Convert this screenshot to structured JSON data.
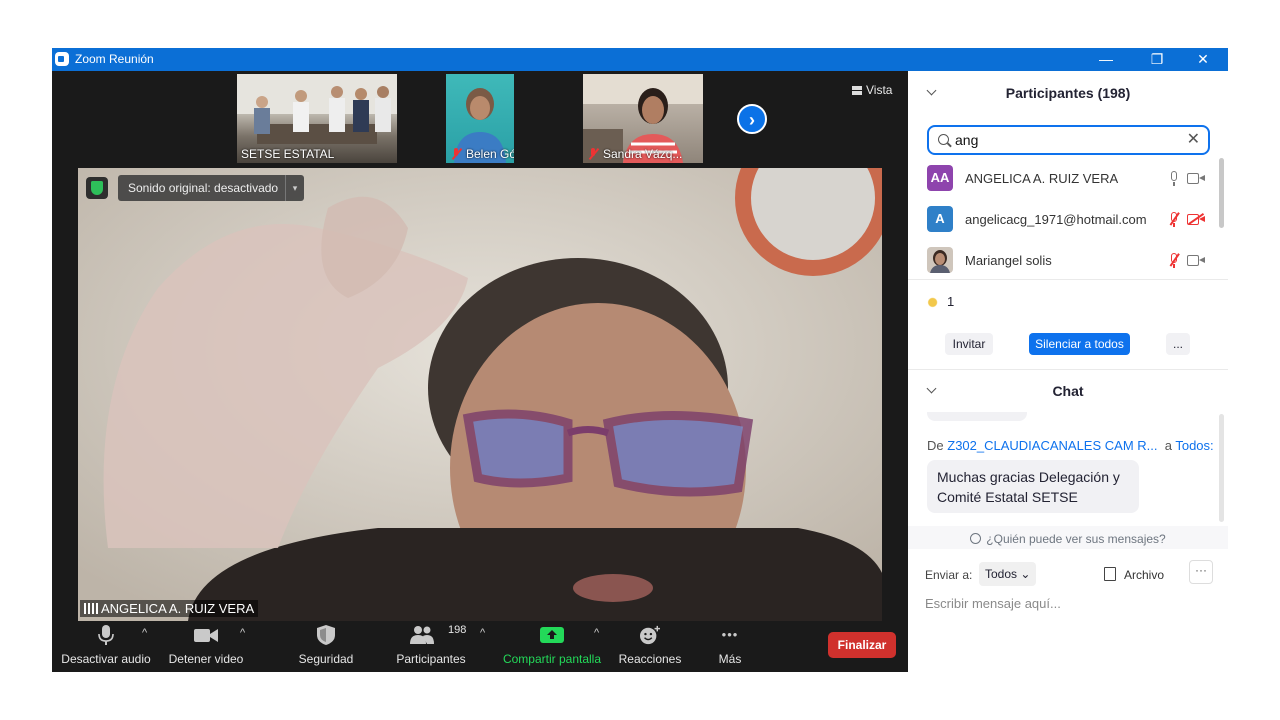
{
  "window": {
    "title": "Zoom Reunión",
    "controls": {
      "minimize": "—",
      "restore": "❐",
      "close": "✕"
    }
  },
  "thumbnails": [
    {
      "name": "SETSE ESTATAL",
      "muted": false
    },
    {
      "name": "Belen Gómez",
      "muted": true
    },
    {
      "name": "Sandra Vázq...",
      "muted": true
    }
  ],
  "view_button": "Vista",
  "next_arrow": "›",
  "video": {
    "original_sound": "Sonido original: desactivado",
    "dropdown_glyph": "▾",
    "speaker_name": "ANGELICA A. RUIZ VERA"
  },
  "toolbar": {
    "audio": "Desactivar audio",
    "video": "Detener video",
    "security": "Seguridad",
    "participants": "Participantes",
    "participants_count": "198",
    "share": "Compartir pantalla",
    "reactions": "Reacciones",
    "more": "Más",
    "more_glyph": "•••",
    "caret": "^",
    "end": "Finalizar"
  },
  "participants_panel": {
    "title": "Participantes (198)",
    "search_value": "ang",
    "search_clear": "✕",
    "list": [
      {
        "initials": "AA",
        "name": "ANGELICA A. RUIZ VERA",
        "avatar_color": "#8e44ad",
        "mic_muted": false,
        "cam_off": false
      },
      {
        "initials": "A",
        "name": "angelicacg_1971@hotmail.com",
        "avatar_color": "#2f80c8",
        "mic_muted": true,
        "cam_off": true
      },
      {
        "initials": "",
        "name": "Mariangel solis",
        "avatar_color": "#6b4a3a",
        "mic_muted": true,
        "cam_off": false
      }
    ],
    "raised_hands": "1",
    "invite": "Invitar",
    "mute_all": "Silenciar a todos",
    "more": "..."
  },
  "chat_panel": {
    "title": "Chat",
    "message": {
      "from_prefix": "De",
      "from": "Z302_CLAUDIACANALES CAM R...",
      "to_prefix": "a",
      "to": "Todos:",
      "text": "Muchas gracias Delegación y Comité Estatal SETSE"
    },
    "who_can_see": "¿Quién puede ver sus mensajes?",
    "send_to_label": "Enviar a:",
    "send_to_value": "Todos",
    "file_label": "Archivo",
    "more": "···",
    "input_placeholder": "Escribir mensaje aquí..."
  },
  "colors": {
    "titlebar": "#0b6fd6",
    "accent": "#0e72ed",
    "end_button": "#d0312d",
    "share_green": "#23d959",
    "muted_red": "#e33333"
  }
}
